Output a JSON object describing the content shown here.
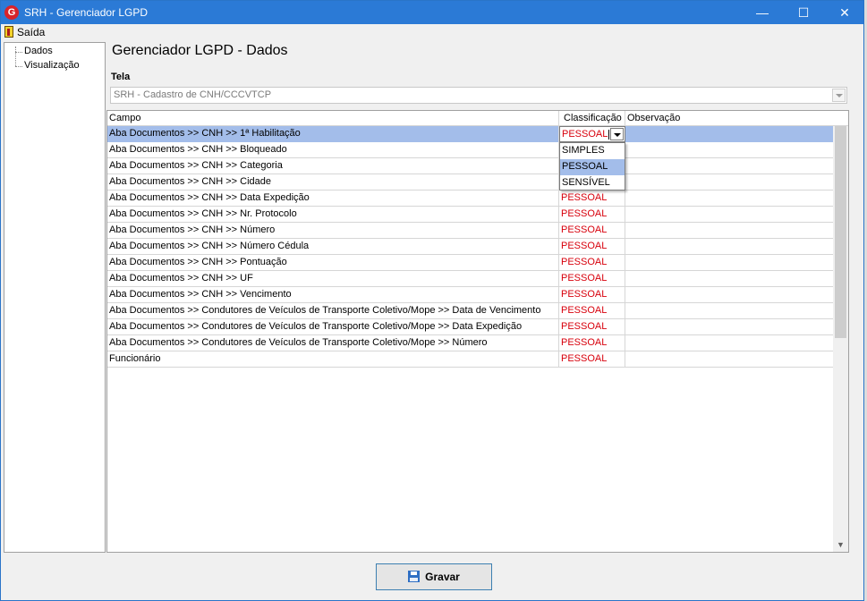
{
  "window": {
    "title": "SRH - Gerenciador LGPD",
    "app_icon": "G",
    "minimize": "—",
    "maximize": "☐",
    "close": "✕"
  },
  "menu": {
    "exit_label": "Saída"
  },
  "tree": {
    "items": [
      {
        "label": "Dados"
      },
      {
        "label": "Visualização"
      }
    ]
  },
  "page": {
    "title": "Gerenciador LGPD - Dados",
    "tela_label": "Tela",
    "tela_value": "SRH - Cadastro de CNH/CCCVTCP"
  },
  "grid": {
    "columns": [
      "Campo",
      "Classificação",
      "Observação"
    ],
    "rows": [
      {
        "campo": "Aba Documentos >> CNH >> 1ª Habilitação",
        "classificacao": "PESSOAL",
        "observacao": ""
      },
      {
        "campo": "Aba Documentos >> CNH >> Bloqueado",
        "classificacao": "",
        "observacao": ""
      },
      {
        "campo": "Aba Documentos >> CNH >> Categoria",
        "classificacao": "",
        "observacao": ""
      },
      {
        "campo": "Aba Documentos >> CNH >> Cidade",
        "classificacao": "",
        "observacao": ""
      },
      {
        "campo": "Aba Documentos >> CNH >> Data Expedição",
        "classificacao": "PESSOAL",
        "observacao": ""
      },
      {
        "campo": "Aba Documentos >> CNH >> Nr. Protocolo",
        "classificacao": "PESSOAL",
        "observacao": ""
      },
      {
        "campo": "Aba Documentos >> CNH >> Número",
        "classificacao": "PESSOAL",
        "observacao": ""
      },
      {
        "campo": "Aba Documentos >> CNH >> Número Cédula",
        "classificacao": "PESSOAL",
        "observacao": ""
      },
      {
        "campo": "Aba Documentos >> CNH >> Pontuação",
        "classificacao": "PESSOAL",
        "observacao": ""
      },
      {
        "campo": "Aba Documentos >> CNH >> UF",
        "classificacao": "PESSOAL",
        "observacao": ""
      },
      {
        "campo": "Aba Documentos >> CNH >> Vencimento",
        "classificacao": "PESSOAL",
        "observacao": ""
      },
      {
        "campo": "Aba Documentos >> Condutores de Veículos de Transporte Coletivo/Mope >> Data de Vencimento",
        "classificacao": "PESSOAL",
        "observacao": ""
      },
      {
        "campo": "Aba Documentos >> Condutores de Veículos de Transporte Coletivo/Mope >> Data Expedição",
        "classificacao": "PESSOAL",
        "observacao": ""
      },
      {
        "campo": "Aba Documentos >> Condutores de Veículos de Transporte Coletivo/Mope >> Número",
        "classificacao": "PESSOAL",
        "observacao": ""
      },
      {
        "campo": "Funcionário",
        "classificacao": "PESSOAL",
        "observacao": ""
      }
    ],
    "dropdown_options": [
      "SIMPLES",
      "PESSOAL",
      "SENSÍVEL"
    ],
    "dropdown_selected": "PESSOAL"
  },
  "buttons": {
    "save_label": "Gravar"
  },
  "colors": {
    "title_bar": "#2b7ad6",
    "selection": "#a3bdea",
    "classification_text": "#d8000c"
  }
}
